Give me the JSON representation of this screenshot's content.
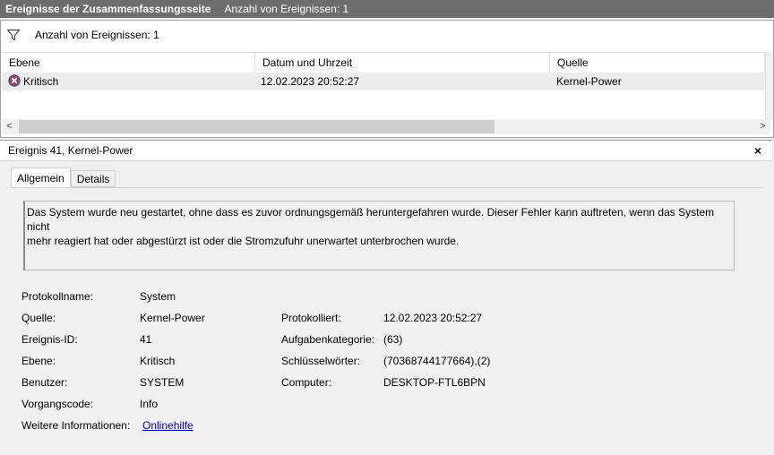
{
  "window": {
    "title": "Ereignisse der Zusammenfassungsseite",
    "count_text": "Anzahl von Ereignissen: 1"
  },
  "filter": {
    "icon": "filter-icon",
    "text": "Anzahl von Ereignissen: 1"
  },
  "grid": {
    "columns": [
      "Ebene",
      "Datum und Uhrzeit",
      "Quelle"
    ],
    "rows": [
      {
        "level_icon": "critical-icon",
        "level": "Kritisch",
        "datetime": "12.02.2023 20:52:27",
        "source": "Kernel-Power"
      }
    ]
  },
  "scroll": {
    "left_arrow": "<",
    "right_arrow": ">"
  },
  "event": {
    "header": "Ereignis 41, Kernel-Power",
    "close": "×",
    "tabs": [
      "Allgemein",
      "Details"
    ],
    "description_line1": "Das System wurde neu gestartet, ohne dass es zuvor ordnungsgemäß heruntergefahren wurde. Dieser Fehler kann auftreten, wenn das System nicht",
    "description_line2": "mehr reagiert hat oder abgestürzt ist oder die Stromzufuhr unerwartet unterbrochen wurde.",
    "fields": {
      "protokollname_label": "Protokollname:",
      "protokollname": "System",
      "quelle_label": "Quelle:",
      "quelle": "Kernel-Power",
      "ereignisid_label": "Ereignis-ID:",
      "ereignisid": "41",
      "ebene_label": "Ebene:",
      "ebene": "Kritisch",
      "benutzer_label": "Benutzer:",
      "benutzer": "SYSTEM",
      "vorgangscode_label": "Vorgangscode:",
      "vorgangscode": "Info",
      "weitere_label": "Weitere Informationen:",
      "weitere_link": "Onlinehilfe",
      "protokolliert_label": "Protokolliert:",
      "protokolliert": "12.02.2023 20:52:27",
      "aufgabe_label": "Aufgabenkategorie:",
      "aufgabe": "(63)",
      "schluessel_label": "Schlüsselwörter:",
      "schluessel": "(70368744177664),(2)",
      "computer_label": "Computer:",
      "computer": "DESKTOP-FTL6BPN"
    }
  }
}
